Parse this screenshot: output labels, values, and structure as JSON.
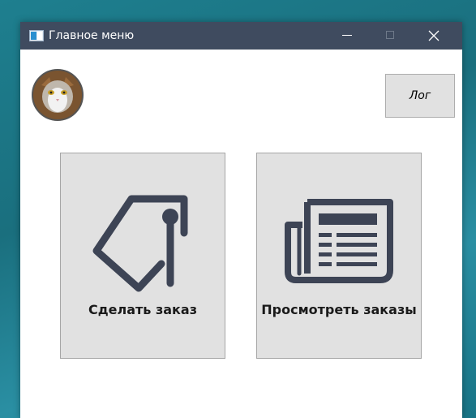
{
  "window": {
    "title": "Главное меню"
  },
  "header": {
    "log_label": "Лог"
  },
  "main": {
    "order_label": "Сделать заказ",
    "view_orders_label": "Просмотреть заказы"
  },
  "icons": {
    "app": "app-window-icon",
    "minimize": "minimize-icon",
    "maximize": "maximize-icon",
    "close": "close-icon",
    "order": "price-tag-icon",
    "view_orders": "newspaper-icon"
  },
  "colors": {
    "titlebar": "#3f4b5f",
    "button_bg": "#e1e1e1",
    "icon": "#3d4455"
  }
}
